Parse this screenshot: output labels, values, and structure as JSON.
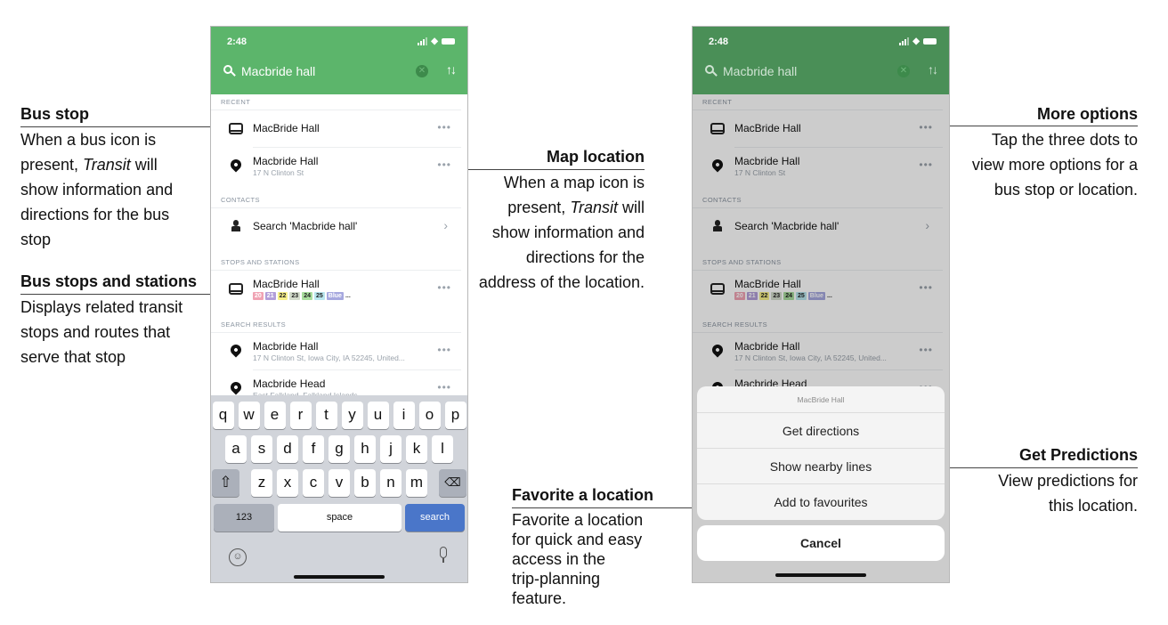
{
  "annotations": {
    "bus_stop": {
      "title": "Bus stop",
      "lines": [
        "When a bus icon is",
        "present, ",
        "Transit",
        " will",
        "show information and",
        "directions for the bus",
        "stop"
      ]
    },
    "bus_stops_stations": {
      "title": "Bus stops and stations",
      "lines": [
        "Displays related transit",
        "stops and routes that",
        "serve that stop"
      ]
    },
    "map_location": {
      "title": "Map location",
      "lines": [
        "When a map icon is",
        "present, ",
        "Transit",
        " will",
        "show information and",
        "directions for the",
        "address of the location."
      ]
    },
    "favorite": {
      "title": "Favorite a location",
      "lines": [
        "Favorite a location",
        "for quick and easy",
        "access in the",
        "trip-planning",
        "feature."
      ]
    },
    "more_options": {
      "title": "More options",
      "lines": [
        "Tap the three dots to",
        "view more options for a",
        "bus stop or location."
      ]
    },
    "predictions": {
      "title": "Get Predictions",
      "lines": [
        "View predictions for",
        "this location."
      ]
    }
  },
  "phone": {
    "time": "2:48",
    "search_value": "Macbride hall",
    "sections": {
      "recent": "RECENT",
      "contacts": "CONTACTS",
      "stops": "STOPS AND STATIONS",
      "results": "SEARCH RESULTS"
    },
    "recent": [
      {
        "icon": "bus-icon",
        "title": "MacBride Hall"
      },
      {
        "icon": "pin-icon",
        "title": "Macbride Hall",
        "subtitle": "17 N Clinton St"
      }
    ],
    "contact": {
      "icon": "person-icon",
      "title": "Search 'Macbride hall'"
    },
    "stop": {
      "icon": "bus-icon",
      "title": "MacBride Hall",
      "routes": [
        {
          "label": "20",
          "bg": "#f0a3b3",
          "fg": "#ffffff"
        },
        {
          "label": "21",
          "bg": "#b29ed9",
          "fg": "#ffffff"
        },
        {
          "label": "22",
          "bg": "#f7f08a",
          "fg": "#222222"
        },
        {
          "label": "23",
          "bg": "#d3dccc",
          "fg": "#222222"
        },
        {
          "label": "24",
          "bg": "#a9dd9e",
          "fg": "#222222"
        },
        {
          "label": "25",
          "bg": "#b9e6ee",
          "fg": "#222222"
        },
        {
          "label": "Blue",
          "bg": "#a6a8df",
          "fg": "#ffffff"
        }
      ],
      "more": "..."
    },
    "results": [
      {
        "icon": "pin-icon",
        "title": "Macbride Hall",
        "subtitle": "17 N Clinton St, Iowa City, IA  52245, United..."
      },
      {
        "icon": "pin-icon",
        "title": "Macbride Head",
        "subtitle": "East Falkland, Falkland Islands"
      }
    ],
    "dots": "•••",
    "keyboard": {
      "row1": [
        "q",
        "w",
        "e",
        "r",
        "t",
        "y",
        "u",
        "i",
        "o",
        "p"
      ],
      "row2": [
        "a",
        "s",
        "d",
        "f",
        "g",
        "h",
        "j",
        "k",
        "l"
      ],
      "row3": [
        "z",
        "x",
        "c",
        "v",
        "b",
        "n",
        "m"
      ],
      "numbers": "123",
      "space": "space",
      "search": "search"
    }
  },
  "action_sheet": {
    "title": "MacBride Hall",
    "options": [
      "Get directions",
      "Show nearby lines",
      "Add to favourites"
    ],
    "cancel": "Cancel"
  }
}
